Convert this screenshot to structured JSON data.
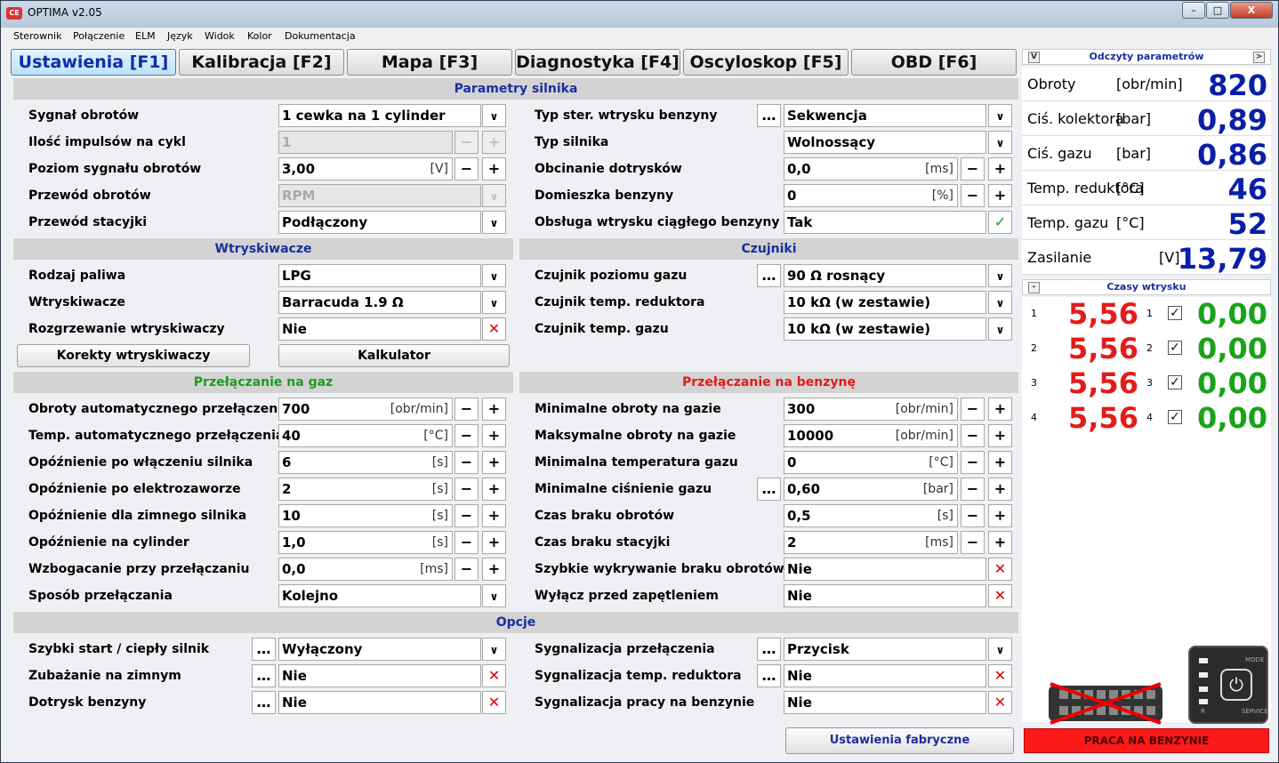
{
  "window": {
    "title": "OPTIMA v2.05",
    "min": "–",
    "max": "□",
    "close": "X"
  },
  "menu": [
    "Sterownik",
    "Połączenie",
    "ELM",
    "Język",
    "Widok",
    "Kolor",
    "Dokumentacja"
  ],
  "tabs": [
    "Ustawienia [F1]",
    "Kalibracja [F2]",
    "Mapa [F3]",
    "Diagnostyka [F4]",
    "Oscyloskop [F5]",
    "OBD [F6]"
  ],
  "sections": {
    "engine": "Parametry silnika",
    "injectors": "Wtryskiwacze",
    "sensors": "Czujniki",
    "to_gas": "Przełączanie na gaz",
    "to_petrol": "Przełączanie na benzynę",
    "options": "Opcje"
  },
  "engine_left": [
    {
      "label": "Sygnał obrotów",
      "value": "1 cewka na 1 cylinder",
      "unit": ""
    },
    {
      "label": "Ilość impulsów na cykl",
      "value": "1",
      "unit": ""
    },
    {
      "label": "Poziom sygnału obrotów",
      "value": "3,00",
      "unit": "[V]"
    },
    {
      "label": "Przewód obrotów",
      "value": "RPM",
      "unit": ""
    },
    {
      "label": "Przewód stacyjki",
      "value": "Podłączony",
      "unit": ""
    }
  ],
  "engine_right": [
    {
      "label": "Typ ster. wtrysku benzyny",
      "value": "Sekwencja",
      "unit": ""
    },
    {
      "label": "Typ silnika",
      "value": "Wolnossący",
      "unit": ""
    },
    {
      "label": "Obcinanie dotrysków",
      "value": "0,0",
      "unit": "[ms]"
    },
    {
      "label": "Domieszka benzyny",
      "value": "0",
      "unit": "[%]"
    },
    {
      "label": "Obsługa wtrysku ciągłego benzyny",
      "value": "Tak",
      "unit": ""
    }
  ],
  "injectors": [
    {
      "label": "Rodzaj paliwa",
      "value": "LPG"
    },
    {
      "label": "Wtryskiwacze",
      "value": "Barracuda 1.9 Ω"
    },
    {
      "label": "Rozgrzewanie wtryskiwaczy",
      "value": "Nie"
    }
  ],
  "injector_buttons": {
    "corrections": "Korekty wtryskiwaczy",
    "calculator": "Kalkulator"
  },
  "sensors": [
    {
      "label": "Czujnik poziomu gazu",
      "value": "90 Ω rosnący"
    },
    {
      "label": "Czujnik temp. reduktora",
      "value": "10 kΩ (w zestawie)"
    },
    {
      "label": "Czujnik temp. gazu",
      "value": "10 kΩ (w zestawie)"
    }
  ],
  "to_gas": [
    {
      "label": "Obroty automatycznego przełączenia",
      "value": "700",
      "unit": "[obr/min]"
    },
    {
      "label": "Temp. automatycznego przełączenia",
      "value": "40",
      "unit": "[°C]"
    },
    {
      "label": "Opóźnienie po włączeniu silnika",
      "value": "6",
      "unit": "[s]"
    },
    {
      "label": "Opóźnienie po elektrozaworze",
      "value": "2",
      "unit": "[s]"
    },
    {
      "label": "Opóźnienie dla zimnego silnika",
      "value": "10",
      "unit": "[s]"
    },
    {
      "label": "Opóźnienie na cylinder",
      "value": "1,0",
      "unit": "[s]"
    },
    {
      "label": "Wzbogacanie przy przełączaniu",
      "value": "0,0",
      "unit": "[ms]"
    },
    {
      "label": "Sposób przełączania",
      "value": "Kolejno",
      "unit": ""
    }
  ],
  "to_petrol": [
    {
      "label": "Minimalne obroty na gazie",
      "value": "300",
      "unit": "[obr/min]"
    },
    {
      "label": "Maksymalne obroty na gazie",
      "value": "10000",
      "unit": "[obr/min]"
    },
    {
      "label": "Minimalna temperatura gazu",
      "value": "0",
      "unit": "[°C]"
    },
    {
      "label": "Minimalne ciśnienie gazu",
      "value": "0,60",
      "unit": "[bar]"
    },
    {
      "label": "Czas braku obrotów",
      "value": "0,5",
      "unit": "[s]"
    },
    {
      "label": "Czas braku stacyjki",
      "value": "2",
      "unit": "[ms]"
    },
    {
      "label": "Szybkie wykrywanie braku obrotów",
      "value": "Nie",
      "unit": ""
    },
    {
      "label": "Wyłącz przed zapętleniem",
      "value": "Nie",
      "unit": ""
    }
  ],
  "options_left": [
    {
      "label": "Szybki start / ciepły silnik",
      "value": "Wyłączony"
    },
    {
      "label": "Zubażanie na zimnym",
      "value": "Nie"
    },
    {
      "label": "Dotrysk benzyny",
      "value": "Nie"
    }
  ],
  "options_right": [
    {
      "label": "Sygnalizacja przełączenia",
      "value": "Przycisk"
    },
    {
      "label": "Sygnalizacja temp. reduktora",
      "value": "Nie"
    },
    {
      "label": "Sygnalizacja pracy na benzynie",
      "value": "Nie"
    }
  ],
  "factory_button": "Ustawienia fabryczne",
  "readings": {
    "title": "Odczyty parametrów",
    "collapse": "V",
    "expand": ">",
    "rows": [
      {
        "name": "Obroty",
        "unit": "[obr/min]",
        "value": "820"
      },
      {
        "name": "Ciś. kolektora",
        "unit": "[bar]",
        "value": "0,89"
      },
      {
        "name": "Ciś. gazu",
        "unit": "[bar]",
        "value": "0,86"
      },
      {
        "name": "Temp. reduktora",
        "unit": "[°C]",
        "value": "46"
      },
      {
        "name": "Temp. gazu",
        "unit": "[°C]",
        "value": "52"
      },
      {
        "name": "Zasilanie",
        "unit": "[V]",
        "value": "13,79"
      }
    ]
  },
  "injection_times": {
    "title": "Czasy wtrysku",
    "collapse": "-",
    "rows": [
      {
        "n": "1",
        "petrol": "5,56",
        "n2": "1",
        "gas": "0,00"
      },
      {
        "n": "2",
        "petrol": "5,56",
        "n2": "2",
        "gas": "0,00"
      },
      {
        "n": "3",
        "petrol": "5,56",
        "n2": "3",
        "gas": "0,00"
      },
      {
        "n": "4",
        "petrol": "5,56",
        "n2": "4",
        "gas": "0,00"
      }
    ]
  },
  "device": {
    "mode": "MODE",
    "service": "SERVICE",
    "r": "R"
  },
  "status": "PRACA NA BENZYNIE",
  "colors": {
    "blue": "#0a1fa8",
    "red": "#e31b1b",
    "green": "#19a319",
    "status": "#ff1a1a"
  }
}
